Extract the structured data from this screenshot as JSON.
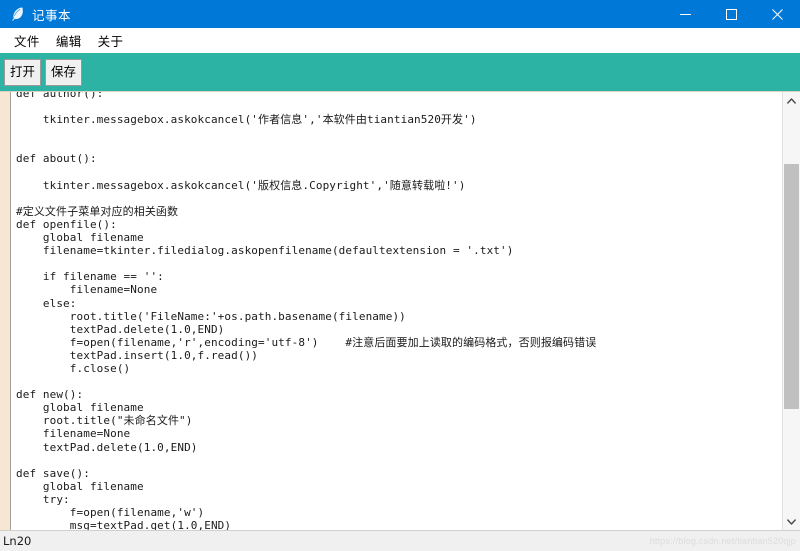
{
  "window": {
    "title": "记事本",
    "icon": "feather-pen-icon",
    "accent_titlebar": "#0078d7",
    "accent_toolbar": "#2cb3a3",
    "controls": {
      "minimize": "minimize-icon",
      "maximize": "maximize-icon",
      "close": "close-icon"
    }
  },
  "menubar": {
    "items": [
      {
        "label": "文件"
      },
      {
        "label": "编辑"
      },
      {
        "label": "关于"
      }
    ]
  },
  "toolbar": {
    "buttons": [
      {
        "label": "打开"
      },
      {
        "label": "保存"
      }
    ]
  },
  "editor": {
    "content": "def author():\n\n    tkinter.messagebox.askokcancel('作者信息','本软件由tiantian520开发')\n\n\ndef about():\n\n    tkinter.messagebox.askokcancel('版权信息.Copyright','随意转载啦!')\n\n#定义文件子菜单对应的相关函数\ndef openfile():\n    global filename\n    filename=tkinter.filedialog.askopenfilename(defaultextension = '.txt')\n\n    if filename == '':\n        filename=None\n    else:\n        root.title('FileName:'+os.path.basename(filename))\n        textPad.delete(1.0,END)\n        f=open(filename,'r',encoding='utf-8')    #注意后面要加上读取的编码格式，否则报编码错误\n        textPad.insert(1.0,f.read())\n        f.close()\n\ndef new():\n    global filename\n    root.title(\"未命名文件\")\n    filename=None\n    textPad.delete(1.0,END)\n\ndef save():\n    global filename\n    try:\n        f=open(filename,'w')\n        msg=textPad.get(1.0,END)"
  },
  "scrollbar": {
    "up_arrow": "chevron-up-icon",
    "down_arrow": "chevron-down-icon"
  },
  "statusbar": {
    "line_indicator": "Ln20"
  },
  "watermark": {
    "text": "https://blog.csdn.net/tiantian520qjp"
  }
}
